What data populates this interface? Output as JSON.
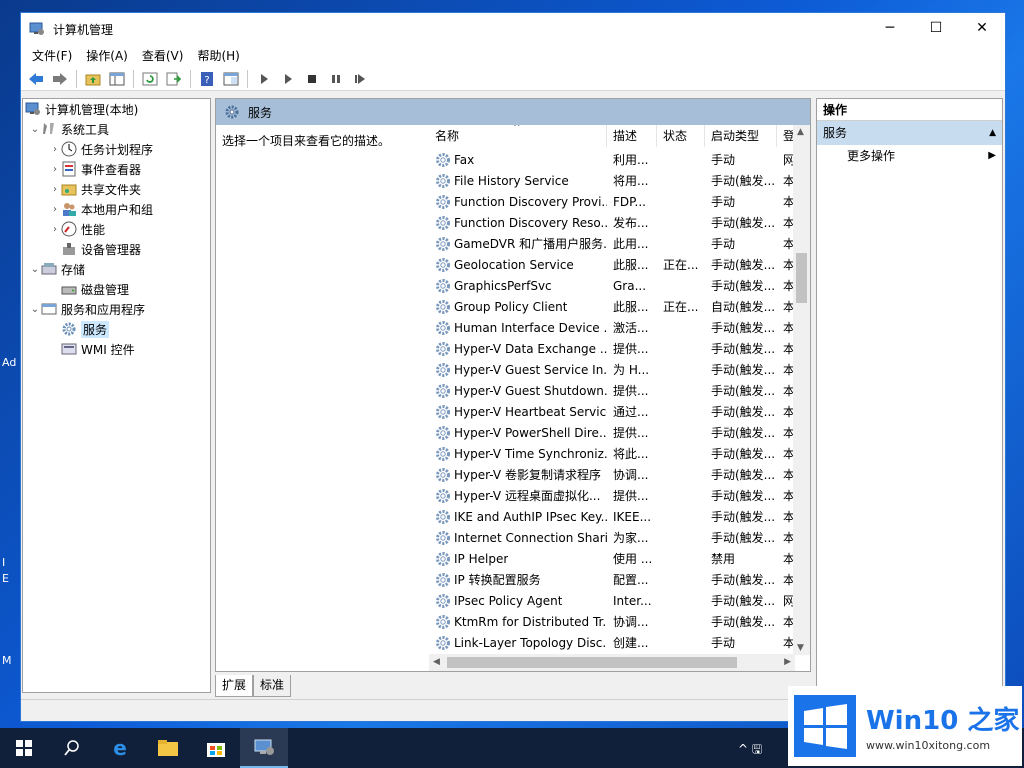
{
  "window": {
    "title": "计算机管理",
    "controls": {
      "minimize": "─",
      "maximize": "☐",
      "close": "✕"
    }
  },
  "menu": [
    "文件(F)",
    "操作(A)",
    "查看(V)",
    "帮助(H)"
  ],
  "toolbar_icons": [
    "back-arrow-icon",
    "forward-arrow-icon",
    "folder-up-icon",
    "show-hide-tree-icon",
    "refresh-icon",
    "export-list-icon",
    "help-icon",
    "properties-icon",
    "start-service-icon",
    "start-service-alt-icon",
    "stop-service-icon",
    "pause-service-icon",
    "restart-service-icon"
  ],
  "tree": [
    {
      "label": "计算机管理(本地)",
      "level": 0,
      "arrow": "",
      "icon": "computer-management-icon"
    },
    {
      "label": "系统工具",
      "level": 1,
      "arrow": "⌄",
      "icon": "system-tools-icon"
    },
    {
      "label": "任务计划程序",
      "level": 2,
      "arrow": "›",
      "icon": "task-scheduler-icon"
    },
    {
      "label": "事件查看器",
      "level": 2,
      "arrow": "›",
      "icon": "event-viewer-icon"
    },
    {
      "label": "共享文件夹",
      "level": 2,
      "arrow": "›",
      "icon": "shared-folders-icon"
    },
    {
      "label": "本地用户和组",
      "level": 2,
      "arrow": "›",
      "icon": "local-users-icon"
    },
    {
      "label": "性能",
      "level": 2,
      "arrow": "›",
      "icon": "performance-icon"
    },
    {
      "label": "设备管理器",
      "level": 2,
      "arrow": "",
      "icon": "device-manager-icon"
    },
    {
      "label": "存储",
      "level": 1,
      "arrow": "⌄",
      "icon": "storage-icon"
    },
    {
      "label": "磁盘管理",
      "level": 2,
      "arrow": "",
      "icon": "disk-management-icon"
    },
    {
      "label": "服务和应用程序",
      "level": 1,
      "arrow": "⌄",
      "icon": "services-apps-icon"
    },
    {
      "label": "服务",
      "level": 2,
      "arrow": "",
      "icon": "services-icon",
      "selected": true
    },
    {
      "label": "WMI 控件",
      "level": 2,
      "arrow": "",
      "icon": "wmi-control-icon"
    }
  ],
  "center": {
    "header": "服务",
    "description_hint": "选择一个项目来查看它的描述。",
    "columns": [
      "名称",
      "描述",
      "状态",
      "启动类型",
      "登"
    ],
    "rows": [
      [
        "Fax",
        "利用...",
        "",
        "手动",
        "网"
      ],
      [
        "File History Service",
        "将用...",
        "",
        "手动(触发...",
        "本"
      ],
      [
        "Function Discovery Provi...",
        "FDP...",
        "",
        "手动",
        "本"
      ],
      [
        "Function Discovery Reso...",
        "发布...",
        "",
        "手动(触发...",
        "本"
      ],
      [
        "GameDVR 和广播用户服务...",
        "此用...",
        "",
        "手动",
        "本"
      ],
      [
        "Geolocation Service",
        "此服...",
        "正在...",
        "手动(触发...",
        "本"
      ],
      [
        "GraphicsPerfSvc",
        "Gra...",
        "",
        "手动(触发...",
        "本"
      ],
      [
        "Group Policy Client",
        "此服...",
        "正在...",
        "自动(触发...",
        "本"
      ],
      [
        "Human Interface Device ...",
        "激活...",
        "",
        "手动(触发...",
        "本"
      ],
      [
        "Hyper-V Data Exchange ...",
        "提供...",
        "",
        "手动(触发...",
        "本"
      ],
      [
        "Hyper-V Guest Service In...",
        "为 H...",
        "",
        "手动(触发...",
        "本"
      ],
      [
        "Hyper-V Guest Shutdown...",
        "提供...",
        "",
        "手动(触发...",
        "本"
      ],
      [
        "Hyper-V Heartbeat Service",
        "通过...",
        "",
        "手动(触发...",
        "本"
      ],
      [
        "Hyper-V PowerShell Dire...",
        "提供...",
        "",
        "手动(触发...",
        "本"
      ],
      [
        "Hyper-V Time Synchroniz...",
        "将此...",
        "",
        "手动(触发...",
        "本"
      ],
      [
        "Hyper-V 卷影复制请求程序",
        "协调...",
        "",
        "手动(触发...",
        "本"
      ],
      [
        "Hyper-V 远程桌面虚拟化...",
        "提供...",
        "",
        "手动(触发...",
        "本"
      ],
      [
        "IKE and AuthIP IPsec Key...",
        "IKEE...",
        "",
        "手动(触发...",
        "本"
      ],
      [
        "Internet Connection Shari...",
        "为家...",
        "",
        "手动(触发...",
        "本"
      ],
      [
        "IP Helper",
        "使用 ...",
        "",
        "禁用",
        "本"
      ],
      [
        "IP 转换配置服务",
        "配置...",
        "",
        "手动(触发...",
        "本"
      ],
      [
        "IPsec Policy Agent",
        "Inter...",
        "",
        "手动(触发...",
        "网"
      ],
      [
        "KtmRm for Distributed Tr...",
        "协调...",
        "",
        "手动(触发...",
        "本"
      ],
      [
        "Link-Layer Topology Disc...",
        "创建...",
        "",
        "手动",
        "本"
      ]
    ]
  },
  "tabs": [
    "扩展",
    "标准"
  ],
  "actions": {
    "header": "操作",
    "section": "服务",
    "items": [
      "更多操作"
    ]
  },
  "desktop_fragments": [
    "Ad",
    "I",
    "E",
    "M"
  ],
  "taskbar": {
    "items": [
      "start-icon",
      "search-icon",
      "edge-icon",
      "file-explorer-icon",
      "store-icon",
      "computer-management-icon"
    ],
    "tray_text": "^ 🖫"
  },
  "watermark": {
    "title": "Win10 之家",
    "url": "www.win10xitong.com"
  },
  "colors": {
    "accent": "#1a73e8",
    "header_bar": "#a7bed8",
    "action_section": "#c8dcf0",
    "taskbar": "#10203a"
  }
}
